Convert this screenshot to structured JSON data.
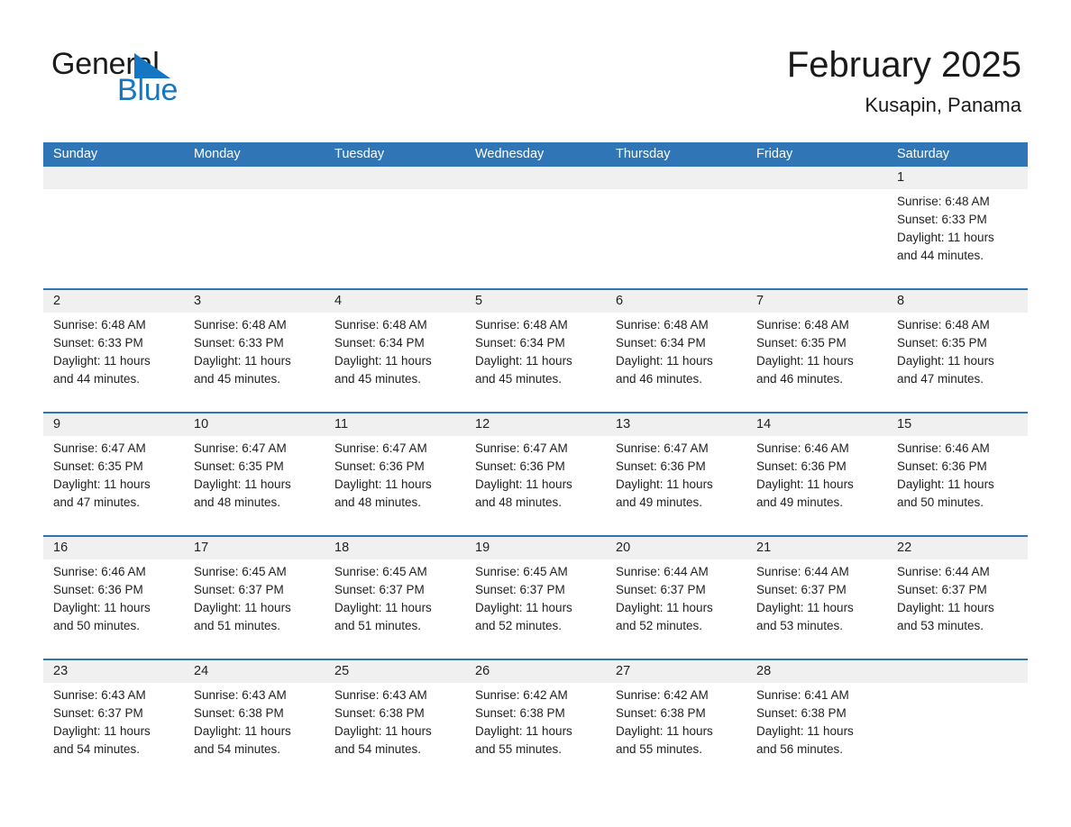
{
  "logo": {
    "word_one": "General",
    "word_two": "Blue",
    "triangle_icon": "triangle-icon",
    "brand_blue": "#1577c4"
  },
  "header": {
    "title": "February 2025",
    "subtitle": "Kusapin, Panama"
  },
  "colors": {
    "header_blue": "#3075b5",
    "day_band_gray": "#f0f0f0",
    "text_dark": "#1f1f1f"
  },
  "calendar": {
    "day_headers": [
      "Sunday",
      "Monday",
      "Tuesday",
      "Wednesday",
      "Thursday",
      "Friday",
      "Saturday"
    ],
    "weeks": [
      [
        {
          "day": "",
          "lines": []
        },
        {
          "day": "",
          "lines": []
        },
        {
          "day": "",
          "lines": []
        },
        {
          "day": "",
          "lines": []
        },
        {
          "day": "",
          "lines": []
        },
        {
          "day": "",
          "lines": []
        },
        {
          "day": "1",
          "lines": [
            "Sunrise: 6:48 AM",
            "Sunset: 6:33 PM",
            "Daylight: 11 hours",
            "and 44 minutes."
          ]
        }
      ],
      [
        {
          "day": "2",
          "lines": [
            "Sunrise: 6:48 AM",
            "Sunset: 6:33 PM",
            "Daylight: 11 hours",
            "and 44 minutes."
          ]
        },
        {
          "day": "3",
          "lines": [
            "Sunrise: 6:48 AM",
            "Sunset: 6:33 PM",
            "Daylight: 11 hours",
            "and 45 minutes."
          ]
        },
        {
          "day": "4",
          "lines": [
            "Sunrise: 6:48 AM",
            "Sunset: 6:34 PM",
            "Daylight: 11 hours",
            "and 45 minutes."
          ]
        },
        {
          "day": "5",
          "lines": [
            "Sunrise: 6:48 AM",
            "Sunset: 6:34 PM",
            "Daylight: 11 hours",
            "and 45 minutes."
          ]
        },
        {
          "day": "6",
          "lines": [
            "Sunrise: 6:48 AM",
            "Sunset: 6:34 PM",
            "Daylight: 11 hours",
            "and 46 minutes."
          ]
        },
        {
          "day": "7",
          "lines": [
            "Sunrise: 6:48 AM",
            "Sunset: 6:35 PM",
            "Daylight: 11 hours",
            "and 46 minutes."
          ]
        },
        {
          "day": "8",
          "lines": [
            "Sunrise: 6:48 AM",
            "Sunset: 6:35 PM",
            "Daylight: 11 hours",
            "and 47 minutes."
          ]
        }
      ],
      [
        {
          "day": "9",
          "lines": [
            "Sunrise: 6:47 AM",
            "Sunset: 6:35 PM",
            "Daylight: 11 hours",
            "and 47 minutes."
          ]
        },
        {
          "day": "10",
          "lines": [
            "Sunrise: 6:47 AM",
            "Sunset: 6:35 PM",
            "Daylight: 11 hours",
            "and 48 minutes."
          ]
        },
        {
          "day": "11",
          "lines": [
            "Sunrise: 6:47 AM",
            "Sunset: 6:36 PM",
            "Daylight: 11 hours",
            "and 48 minutes."
          ]
        },
        {
          "day": "12",
          "lines": [
            "Sunrise: 6:47 AM",
            "Sunset: 6:36 PM",
            "Daylight: 11 hours",
            "and 48 minutes."
          ]
        },
        {
          "day": "13",
          "lines": [
            "Sunrise: 6:47 AM",
            "Sunset: 6:36 PM",
            "Daylight: 11 hours",
            "and 49 minutes."
          ]
        },
        {
          "day": "14",
          "lines": [
            "Sunrise: 6:46 AM",
            "Sunset: 6:36 PM",
            "Daylight: 11 hours",
            "and 49 minutes."
          ]
        },
        {
          "day": "15",
          "lines": [
            "Sunrise: 6:46 AM",
            "Sunset: 6:36 PM",
            "Daylight: 11 hours",
            "and 50 minutes."
          ]
        }
      ],
      [
        {
          "day": "16",
          "lines": [
            "Sunrise: 6:46 AM",
            "Sunset: 6:36 PM",
            "Daylight: 11 hours",
            "and 50 minutes."
          ]
        },
        {
          "day": "17",
          "lines": [
            "Sunrise: 6:45 AM",
            "Sunset: 6:37 PM",
            "Daylight: 11 hours",
            "and 51 minutes."
          ]
        },
        {
          "day": "18",
          "lines": [
            "Sunrise: 6:45 AM",
            "Sunset: 6:37 PM",
            "Daylight: 11 hours",
            "and 51 minutes."
          ]
        },
        {
          "day": "19",
          "lines": [
            "Sunrise: 6:45 AM",
            "Sunset: 6:37 PM",
            "Daylight: 11 hours",
            "and 52 minutes."
          ]
        },
        {
          "day": "20",
          "lines": [
            "Sunrise: 6:44 AM",
            "Sunset: 6:37 PM",
            "Daylight: 11 hours",
            "and 52 minutes."
          ]
        },
        {
          "day": "21",
          "lines": [
            "Sunrise: 6:44 AM",
            "Sunset: 6:37 PM",
            "Daylight: 11 hours",
            "and 53 minutes."
          ]
        },
        {
          "day": "22",
          "lines": [
            "Sunrise: 6:44 AM",
            "Sunset: 6:37 PM",
            "Daylight: 11 hours",
            "and 53 minutes."
          ]
        }
      ],
      [
        {
          "day": "23",
          "lines": [
            "Sunrise: 6:43 AM",
            "Sunset: 6:37 PM",
            "Daylight: 11 hours",
            "and 54 minutes."
          ]
        },
        {
          "day": "24",
          "lines": [
            "Sunrise: 6:43 AM",
            "Sunset: 6:38 PM",
            "Daylight: 11 hours",
            "and 54 minutes."
          ]
        },
        {
          "day": "25",
          "lines": [
            "Sunrise: 6:43 AM",
            "Sunset: 6:38 PM",
            "Daylight: 11 hours",
            "and 54 minutes."
          ]
        },
        {
          "day": "26",
          "lines": [
            "Sunrise: 6:42 AM",
            "Sunset: 6:38 PM",
            "Daylight: 11 hours",
            "and 55 minutes."
          ]
        },
        {
          "day": "27",
          "lines": [
            "Sunrise: 6:42 AM",
            "Sunset: 6:38 PM",
            "Daylight: 11 hours",
            "and 55 minutes."
          ]
        },
        {
          "day": "28",
          "lines": [
            "Sunrise: 6:41 AM",
            "Sunset: 6:38 PM",
            "Daylight: 11 hours",
            "and 56 minutes."
          ]
        },
        {
          "day": "",
          "lines": []
        }
      ]
    ]
  }
}
